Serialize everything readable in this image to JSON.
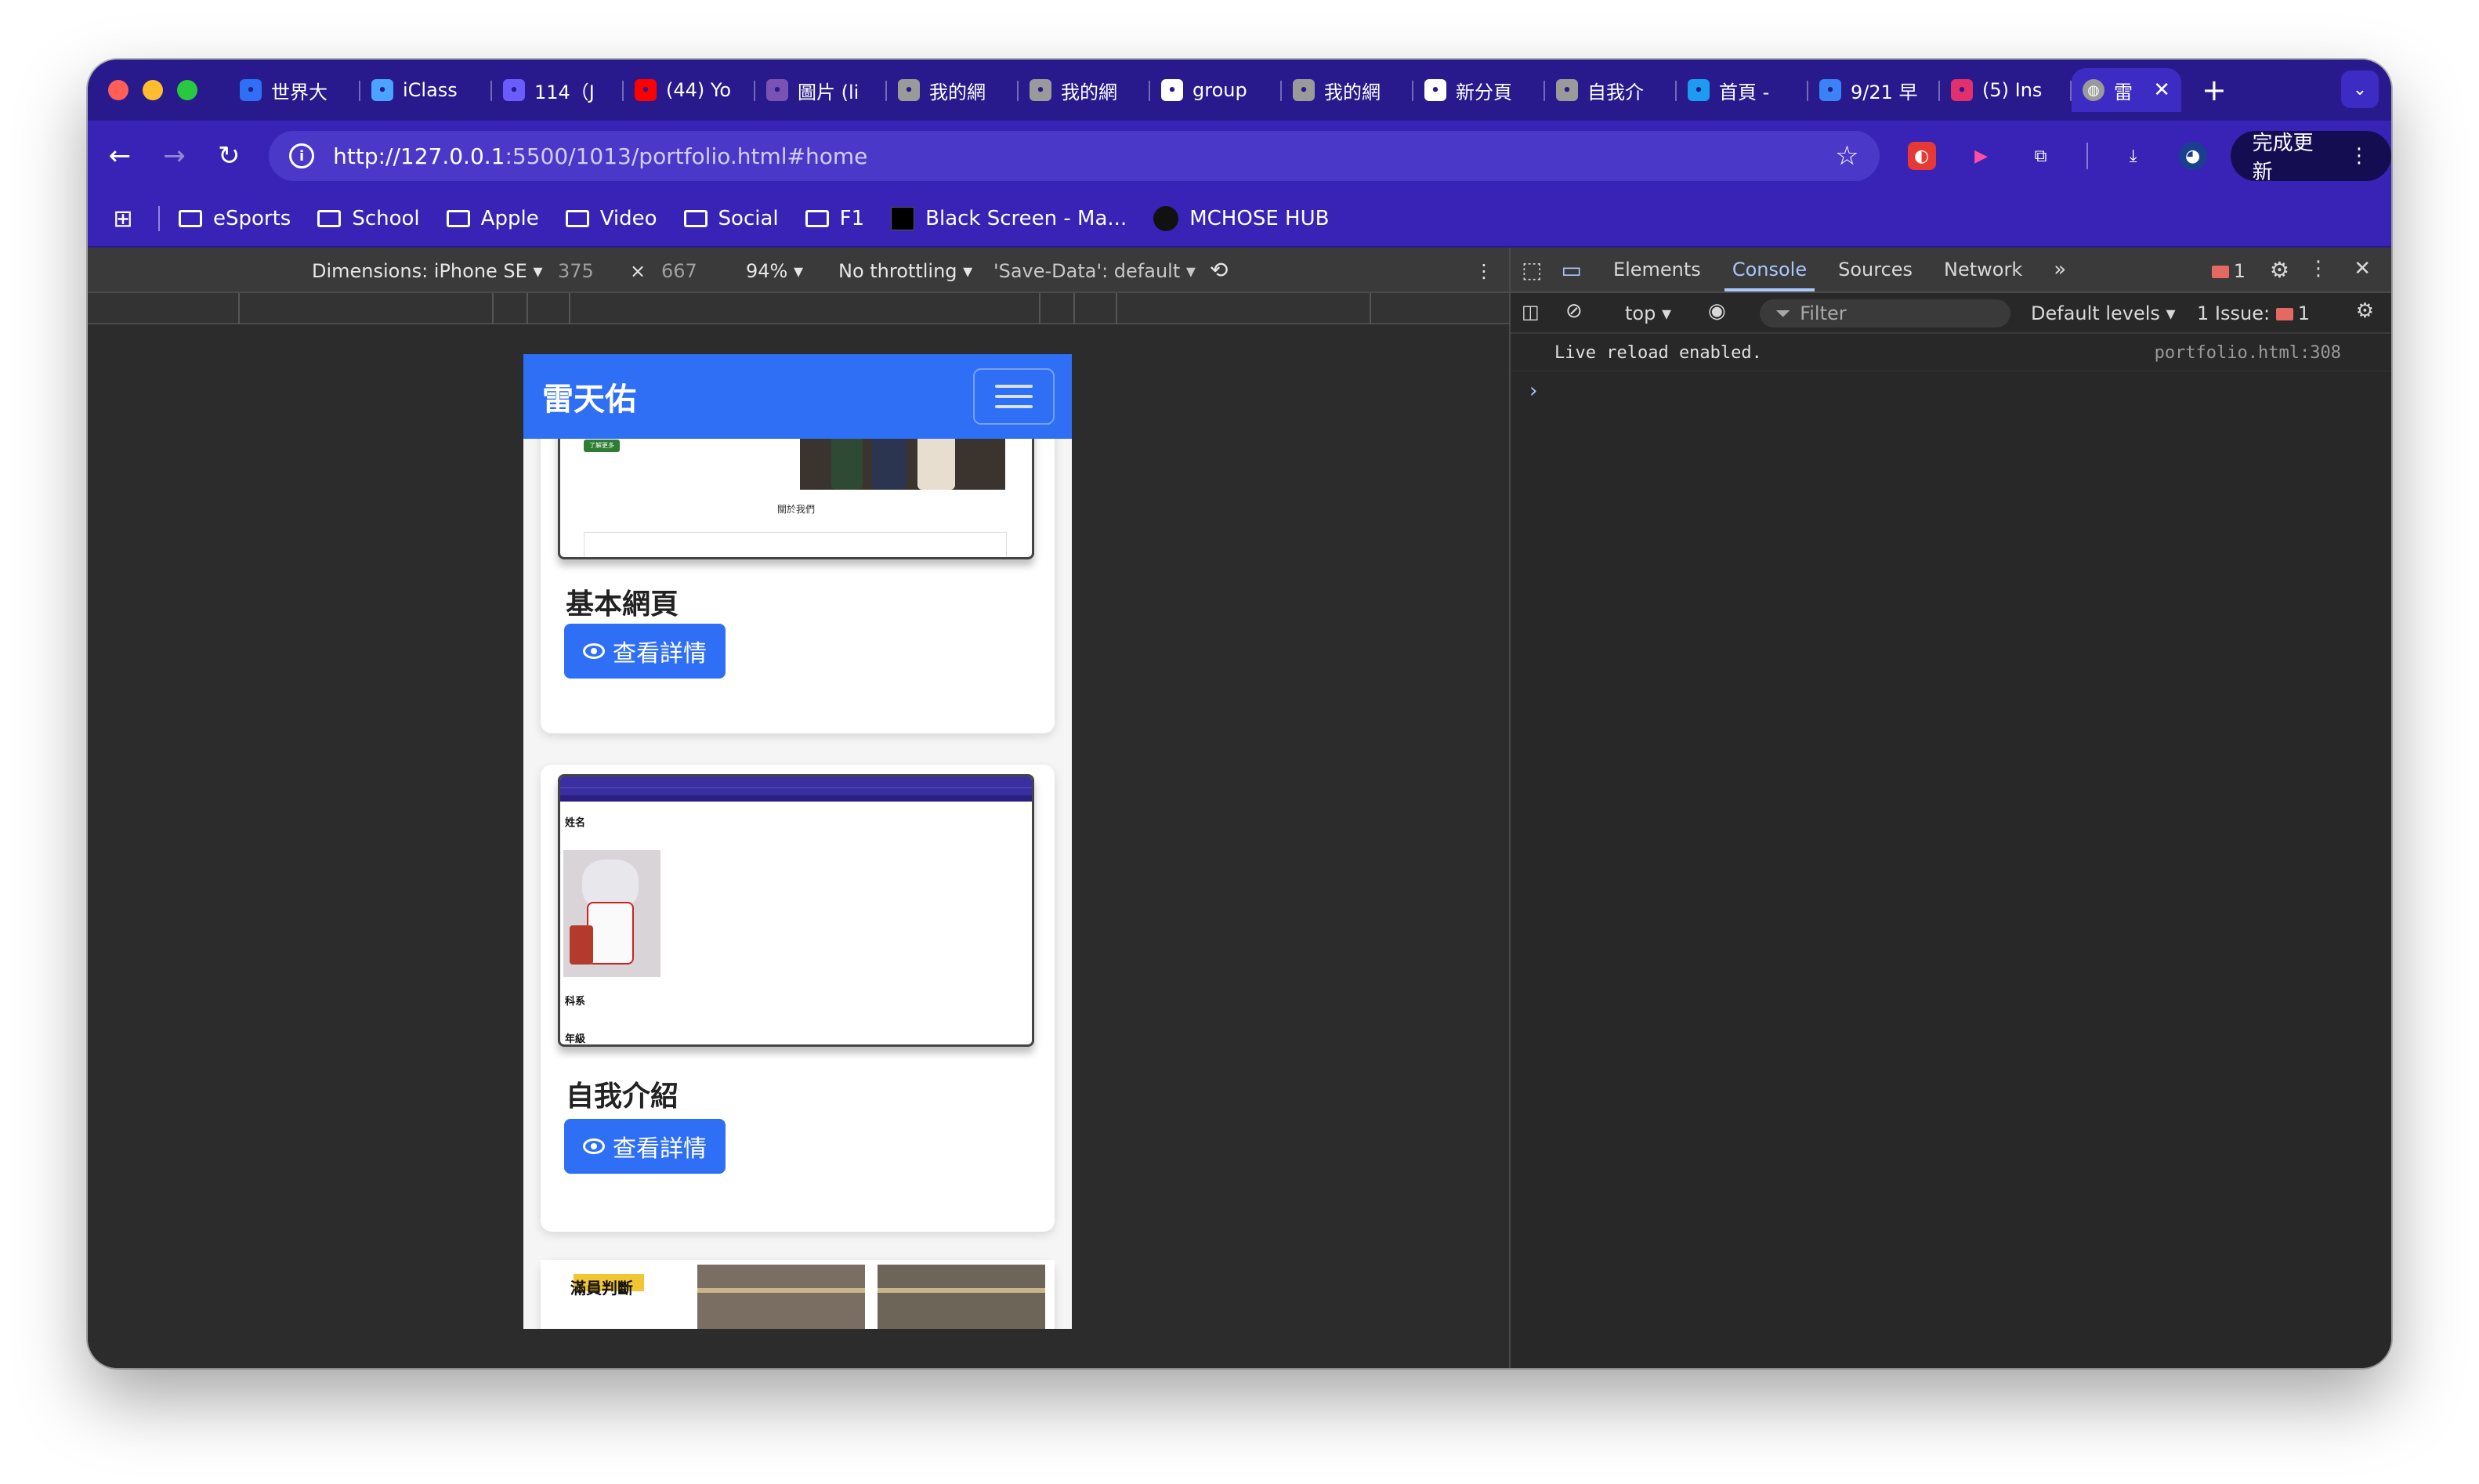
{
  "browser": {
    "tabs": [
      {
        "title": "世界大",
        "icon": "link-icon",
        "color": "#2f6ff5"
      },
      {
        "title": "iClass",
        "icon": "iclass-icon",
        "color": "#4aa3ff"
      },
      {
        "title": "114（J",
        "icon": "layers-icon",
        "color": "#6b5cff"
      },
      {
        "title": "(44) Yo",
        "icon": "youtube-icon",
        "color": "#ff0000"
      },
      {
        "title": "圖片 (li",
        "icon": "bootstrap-icon",
        "color": "#7952b3"
      },
      {
        "title": "我的網",
        "icon": "globe-icon",
        "color": "#9a9a9a"
      },
      {
        "title": "我的網",
        "icon": "globe-icon",
        "color": "#9a9a9a"
      },
      {
        "title": "group",
        "icon": "google-icon",
        "color": "#ffffff"
      },
      {
        "title": "我的網",
        "icon": "globe-icon",
        "color": "#9a9a9a"
      },
      {
        "title": "新分頁",
        "icon": "chrome-icon",
        "color": "#ffffff"
      },
      {
        "title": "自我介",
        "icon": "globe-icon",
        "color": "#9a9a9a"
      },
      {
        "title": "首頁 -",
        "icon": "edge-icon",
        "color": "#1d9bf0"
      },
      {
        "title": "9/21 早",
        "icon": "chat-icon",
        "color": "#3b82f6"
      },
      {
        "title": "(5) Ins",
        "icon": "instagram-icon",
        "color": "#e1306c"
      }
    ],
    "active_tab": {
      "title": "雷",
      "icon": "globe-icon"
    },
    "url_host": "http://127.0.0.1",
    "url_path": ":5500/1013/portfolio.html#home",
    "update_label": "完成更新",
    "bookmarks": [
      {
        "label": "eSports",
        "type": "folder"
      },
      {
        "label": "School",
        "type": "folder"
      },
      {
        "label": "Apple",
        "type": "folder"
      },
      {
        "label": "Video",
        "type": "folder"
      },
      {
        "label": "Social",
        "type": "folder"
      },
      {
        "label": "F1",
        "type": "folder"
      },
      {
        "label": "Black Screen - Ma...",
        "type": "square"
      },
      {
        "label": "MCHOSE HUB",
        "type": "circle"
      }
    ]
  },
  "device_toolbar": {
    "dimensions_label": "Dimensions: iPhone SE",
    "width": "375",
    "times": "×",
    "height": "667",
    "zoom": "94%",
    "throttling": "No throttling",
    "save_data": "'Save-Data': default"
  },
  "page": {
    "brand": "雷天佑",
    "cards": [
      {
        "title": "基本網頁",
        "button": "查看詳情",
        "shot_caption": "關於我們",
        "shot_button": "了解更多"
      },
      {
        "title": "自我介紹",
        "button": "查看詳情",
        "shot_heading_1": "姓名",
        "shot_heading_2": "科系",
        "shot_heading_3": "年級"
      },
      {
        "shot_label": "滿員判斷"
      }
    ]
  },
  "devtools": {
    "tabs": [
      "Elements",
      "Console",
      "Sources",
      "Network"
    ],
    "active_tab": "Console",
    "error_count": "1",
    "context": "top",
    "filter_placeholder": "Filter",
    "levels": "Default levels",
    "issues_label": "1 Issue:",
    "issues_count": "1",
    "console_message": "Live reload enabled.",
    "console_source": "portfolio.html:308"
  }
}
